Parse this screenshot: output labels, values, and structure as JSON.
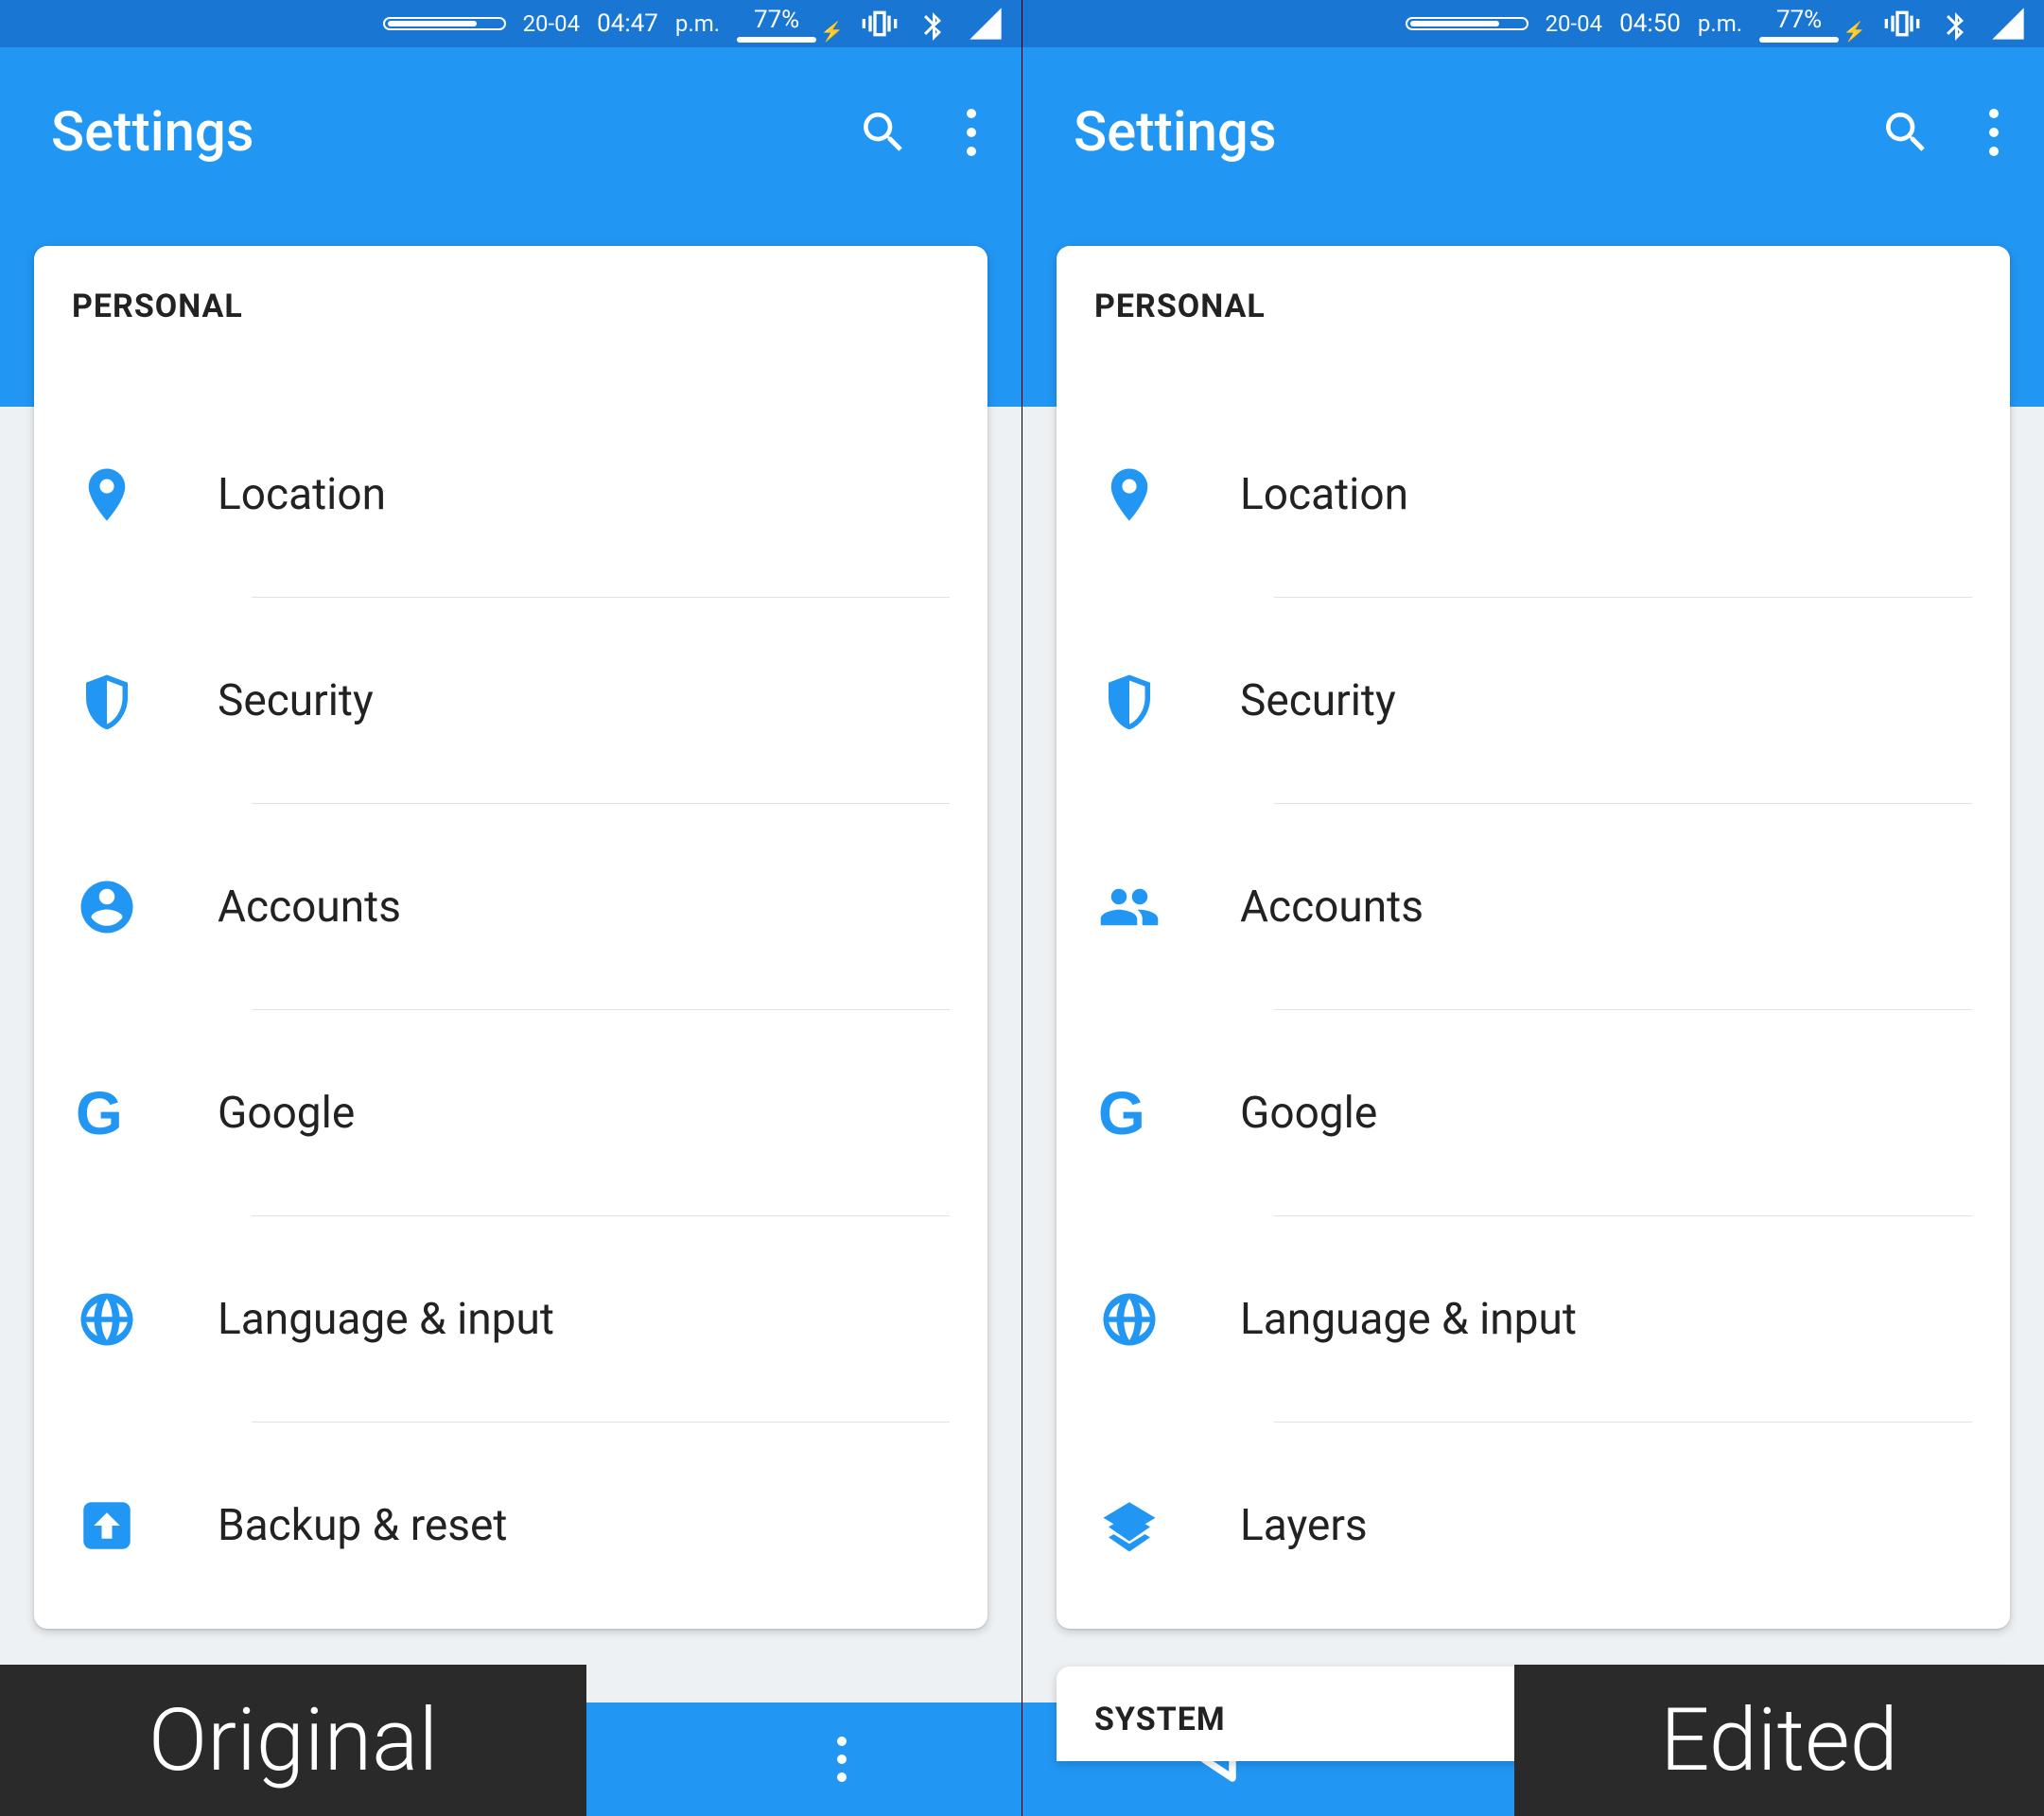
{
  "left": {
    "status": {
      "date": "20-04",
      "time": "04:47",
      "ampm": "p.m.",
      "battery_pct": "77%"
    },
    "appbar": {
      "title": "Settings"
    },
    "section": "PERSONAL",
    "items": [
      {
        "icon": "location-icon",
        "label": "Location"
      },
      {
        "icon": "shield-icon",
        "label": "Security"
      },
      {
        "icon": "account-circle-icon",
        "label": "Accounts"
      },
      {
        "icon": "google-icon",
        "label": "Google"
      },
      {
        "icon": "globe-icon",
        "label": "Language & input"
      },
      {
        "icon": "backup-icon",
        "label": "Backup & reset"
      }
    ],
    "caption": "Original"
  },
  "right": {
    "status": {
      "date": "20-04",
      "time": "04:50",
      "ampm": "p.m.",
      "battery_pct": "77%"
    },
    "appbar": {
      "title": "Settings"
    },
    "section": "PERSONAL",
    "items": [
      {
        "icon": "location-icon",
        "label": "Location"
      },
      {
        "icon": "shield-icon",
        "label": "Security"
      },
      {
        "icon": "people-icon",
        "label": "Accounts"
      },
      {
        "icon": "google-icon",
        "label": "Google"
      },
      {
        "icon": "globe-icon",
        "label": "Language & input"
      },
      {
        "icon": "layers-icon",
        "label": "Layers"
      }
    ],
    "peek_section": "SYSTEM",
    "caption": "Edited"
  },
  "colors": {
    "accent": "#2196f3",
    "status": "#1976d2"
  }
}
